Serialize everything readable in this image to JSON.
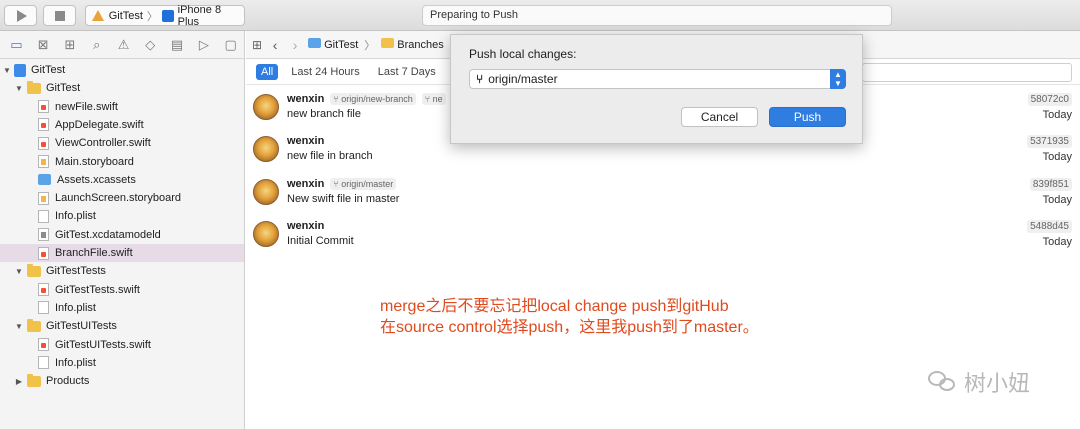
{
  "toolbar": {
    "scheme": "GitTest",
    "device": "iPhone 8 Plus",
    "status": "Preparing to Push"
  },
  "navigator_icons": [
    "folder-icon",
    "source-control-icon",
    "hierarchy-icon",
    "search-icon",
    "warning-icon",
    "test-icon",
    "debug-icon",
    "breakpoint-icon",
    "report-icon"
  ],
  "tree": [
    {
      "label": "GitTest",
      "kind": "project",
      "level": 0,
      "expanded": true
    },
    {
      "label": "GitTest",
      "kind": "folder",
      "level": 1,
      "expanded": true
    },
    {
      "label": "newFile.swift",
      "kind": "swift",
      "level": 2
    },
    {
      "label": "AppDelegate.swift",
      "kind": "swift",
      "level": 2
    },
    {
      "label": "ViewController.swift",
      "kind": "swift",
      "level": 2
    },
    {
      "label": "Main.storyboard",
      "kind": "storyboard",
      "level": 2
    },
    {
      "label": "Assets.xcassets",
      "kind": "assets",
      "level": 2
    },
    {
      "label": "LaunchScreen.storyboard",
      "kind": "storyboard",
      "level": 2
    },
    {
      "label": "Info.plist",
      "kind": "plist",
      "level": 2
    },
    {
      "label": "GitTest.xcdatamodeld",
      "kind": "model",
      "level": 2
    },
    {
      "label": "BranchFile.swift",
      "kind": "swift",
      "level": 2,
      "selected": true
    },
    {
      "label": "GitTestTests",
      "kind": "folder",
      "level": 1,
      "expanded": true
    },
    {
      "label": "GitTestTests.swift",
      "kind": "swift",
      "level": 2
    },
    {
      "label": "Info.plist",
      "kind": "plist",
      "level": 2
    },
    {
      "label": "GitTestUITests",
      "kind": "folder",
      "level": 1,
      "expanded": true
    },
    {
      "label": "GitTestUITests.swift",
      "kind": "swift",
      "level": 2
    },
    {
      "label": "Info.plist",
      "kind": "plist",
      "level": 2
    },
    {
      "label": "Products",
      "kind": "folder",
      "level": 1,
      "expanded": false
    }
  ],
  "jumpbar": {
    "project": "GitTest",
    "section": "Branches"
  },
  "filters": {
    "all": "All",
    "last24": "Last 24 Hours",
    "last7": "Last 7 Days"
  },
  "commits": [
    {
      "author": "wenxin",
      "tags": [
        "origin/new-branch",
        "ne"
      ],
      "message": "new branch file",
      "sha": "58072c0",
      "when": "Today"
    },
    {
      "author": "wenxin",
      "tags": [],
      "message": "new file in branch",
      "sha": "5371935",
      "when": "Today"
    },
    {
      "author": "wenxin",
      "tags": [
        "origin/master"
      ],
      "message": "New swift file in master",
      "sha": "839f851",
      "when": "Today"
    },
    {
      "author": "wenxin",
      "tags": [],
      "message": "Initial Commit",
      "sha": "5488d45",
      "when": "Today"
    }
  ],
  "push_sheet": {
    "title": "Push local changes:",
    "remote": "origin/master",
    "cancel": "Cancel",
    "push": "Push"
  },
  "annotation": {
    "line1": "merge之后不要忘记把local change push到gitHub",
    "line2": "在source control选择push，这里我push到了master。"
  },
  "watermark": "树小妞",
  "colors": {
    "accent": "#2f7de1",
    "annotation": "#e04a1e",
    "selected_row": "#e6dbe6"
  }
}
